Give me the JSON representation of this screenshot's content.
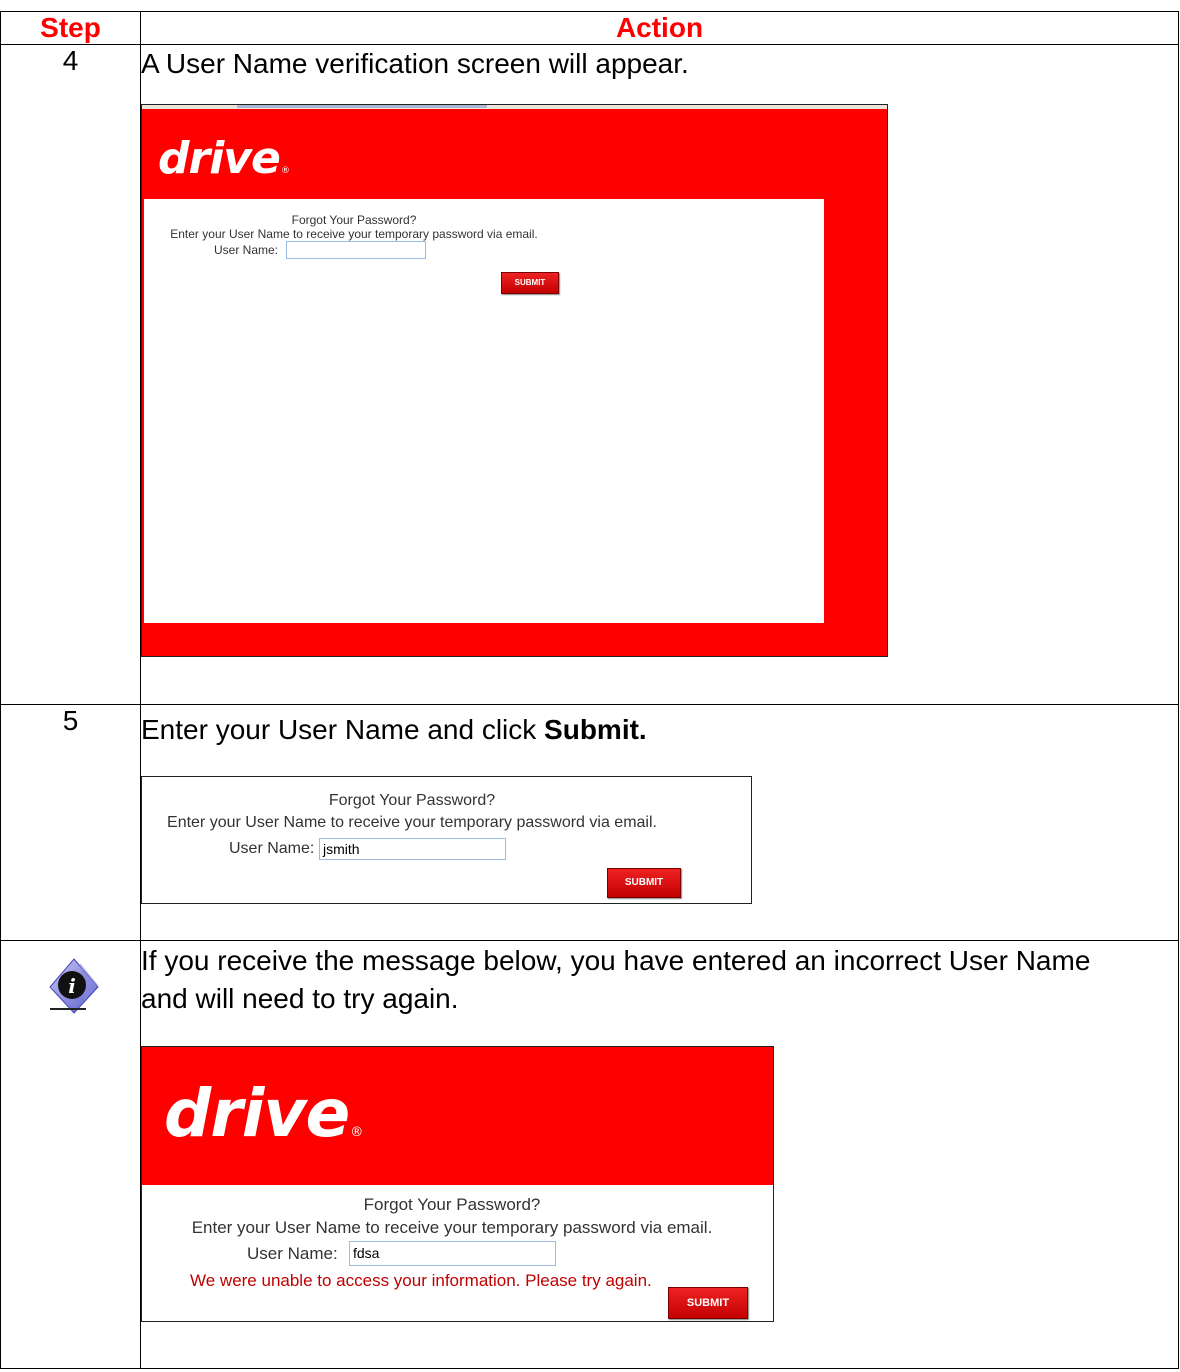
{
  "header": {
    "step": "Step",
    "action": "Action"
  },
  "rows": [
    {
      "step": "4",
      "instruction": "A User Name verification screen will appear."
    },
    {
      "step": "5",
      "instruction_plain": "Enter your User Name and click ",
      "instruction_bold": "Submit."
    },
    {
      "step_icon": "info-icon",
      "instruction": "If you receive the message below, you have entered an incorrect User Name and will need to try again."
    }
  ],
  "screenshots": {
    "logo_text": "drive",
    "logo_mark": "®",
    "heading": "Forgot Your Password?",
    "prompt": "Enter your User Name to receive your temporary password via email.",
    "user_label": "User Name:",
    "submit_label": "SUBMIT",
    "values": {
      "shot1": "",
      "shot2": "jsmith",
      "shot3": "fdsa"
    },
    "error": "We were unable to access your information. Please try again."
  },
  "colors": {
    "brand_red": "#ff0000",
    "header_text": "#ff0000",
    "error_text": "#c00000"
  }
}
